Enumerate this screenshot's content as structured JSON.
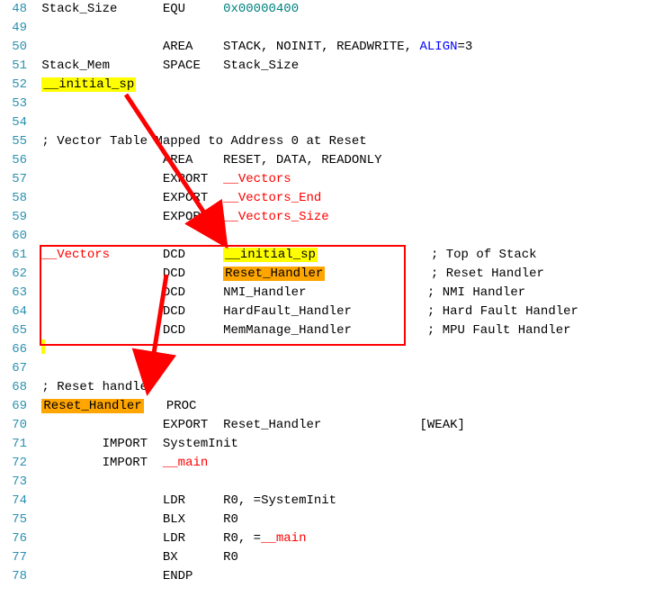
{
  "lines": {
    "48": {
      "ln": "48",
      "c1": "Stack_Size",
      "c2": "EQU",
      "c3": "0x00000400"
    },
    "49": {
      "ln": "49"
    },
    "50": {
      "ln": "50",
      "c2": "AREA",
      "c3a": "STACK, NOINIT, READWRITE, ",
      "c3b": "ALIGN",
      "c3c": "=3"
    },
    "51": {
      "ln": "51",
      "c1": "Stack_Mem",
      "c2": "SPACE",
      "c3": "Stack_Size"
    },
    "52": {
      "ln": "52",
      "c1hl": "__initial_sp"
    },
    "53": {
      "ln": "53"
    },
    "54": {
      "ln": "54"
    },
    "55": {
      "ln": "55",
      "comment": "; Vector Table Mapped to Address 0 at Reset"
    },
    "56": {
      "ln": "56",
      "c2": "AREA",
      "c3": "RESET, DATA, READONLY"
    },
    "57": {
      "ln": "57",
      "c2": "EXPORT",
      "c3red": "__Vectors"
    },
    "58": {
      "ln": "58",
      "c2": "EXPORT",
      "c3red": "__Vectors_End"
    },
    "59": {
      "ln": "59",
      "c2": "EXPORT",
      "c3red": "__Vectors_Size"
    },
    "60": {
      "ln": "60"
    },
    "61": {
      "ln": "61",
      "c1red": "__Vectors",
      "c2": "DCD",
      "c3hly": "__initial_sp",
      "comment": "; Top of Stack"
    },
    "62": {
      "ln": "62",
      "c2": "DCD",
      "c3hlo": "Reset_Handler",
      "comment": "; Reset Handler"
    },
    "63": {
      "ln": "63",
      "c2": "DCD",
      "c3": "NMI_Handler",
      "comment": "; NMI Handler"
    },
    "64": {
      "ln": "64",
      "c2": "DCD",
      "c3": "HardFault_Handler",
      "comment": "; Hard Fault Handler"
    },
    "65": {
      "ln": "65",
      "c2": "DCD",
      "c3": "MemManage_Handler",
      "comment": "; MPU Fault Handler"
    },
    "66": {
      "ln": "66"
    },
    "67": {
      "ln": "67"
    },
    "68": {
      "ln": "68",
      "comment": "; Reset handler"
    },
    "69": {
      "ln": "69",
      "c1hlo": "Reset_Handler",
      "c2": "PROC"
    },
    "70": {
      "ln": "70",
      "c2": "EXPORT",
      "c3": "Reset_Handler",
      "c4": "[WEAK]"
    },
    "71": {
      "ln": "71",
      "c1b": "IMPORT",
      "c2b": "SystemInit"
    },
    "72": {
      "ln": "72",
      "c1b": "IMPORT",
      "c2bred": "__main"
    },
    "73": {
      "ln": "73"
    },
    "74": {
      "ln": "74",
      "c2": "LDR",
      "c3": "R0, =SystemInit"
    },
    "75": {
      "ln": "75",
      "c2": "BLX",
      "c3": "R0"
    },
    "76": {
      "ln": "76",
      "c2": "LDR",
      "c3a": "R0, =",
      "c3red": "__main"
    },
    "77": {
      "ln": "77",
      "c2": "BX",
      "c3": "R0"
    },
    "78": {
      "ln": "78",
      "c2": "ENDP"
    }
  }
}
